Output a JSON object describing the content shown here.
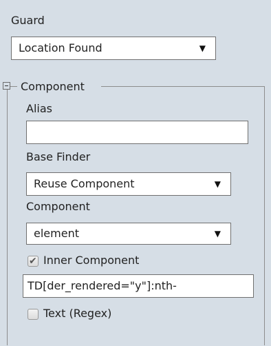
{
  "guard": {
    "label": "Guard",
    "selected": "Location Found",
    "caret": "▼"
  },
  "component_group": {
    "legend": "Component",
    "collapse_icon": "minus-box",
    "alias": {
      "label": "Alias",
      "value": ""
    },
    "base_finder": {
      "label": "Base Finder",
      "selected": "Reuse Component",
      "caret": "▼"
    },
    "component": {
      "label": "Component",
      "selected": "element",
      "caret": "▼"
    },
    "inner_component": {
      "label": "Inner Component",
      "checked": true,
      "check_glyph": "✔"
    },
    "selector": {
      "value": "TD[der_rendered=\"y\"]:nth-"
    },
    "text_regex": {
      "label": "Text (Regex)",
      "checked": false
    }
  }
}
